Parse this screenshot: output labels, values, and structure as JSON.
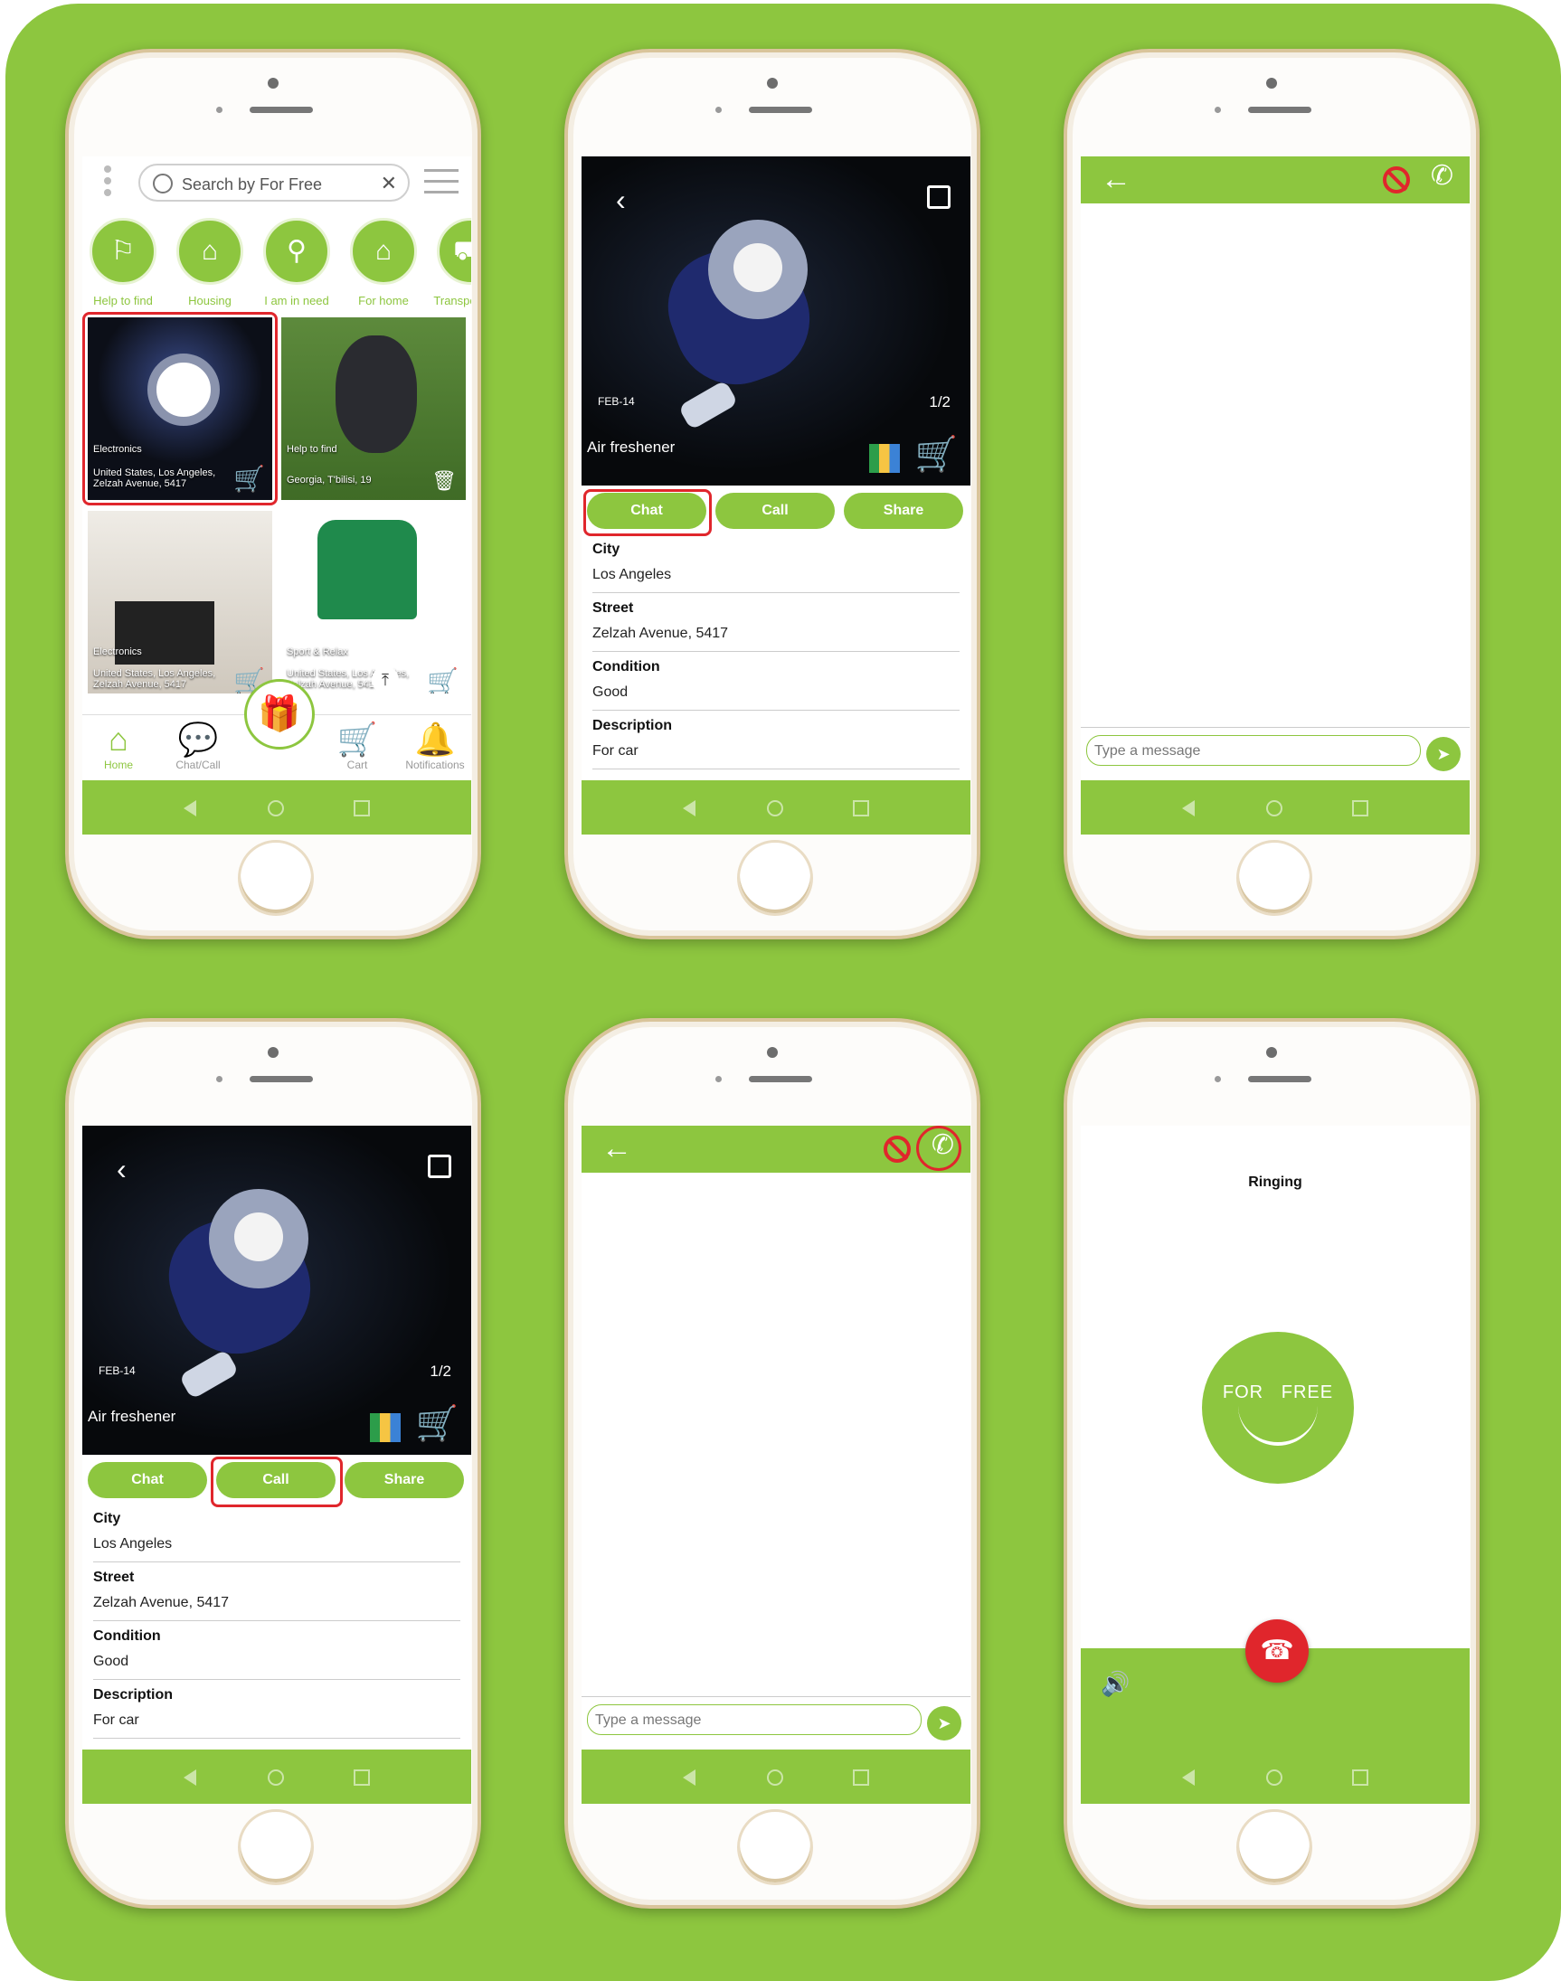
{
  "search": {
    "placeholder": "Search by For Free"
  },
  "categories": [
    "Help to find",
    "Housing",
    "I am in need",
    "For home",
    "Transpo & p..."
  ],
  "tiles": [
    {
      "category": "Electronics",
      "address": "United States, Los Angeles, Zelzah Avenue, 5417"
    },
    {
      "category": "Help to find",
      "address": "Georgia, T'bilisi, 19"
    },
    {
      "category": "Electronics",
      "address": "United States, Los Angeles, Zelzah Avenue, 5417"
    },
    {
      "category": "Sport & Relax",
      "address": "United States, Los Angeles, Zelzah Avenue, 5417"
    }
  ],
  "tabs": [
    "Home",
    "Chat/Call",
    "Cart",
    "Notifications"
  ],
  "item": {
    "date": "FEB-14",
    "counter": "1/2",
    "name": "Air freshener",
    "buttons": {
      "chat": "Chat",
      "call": "Call",
      "share": "Share"
    },
    "fields": [
      {
        "label": "City",
        "value": "Los Angeles"
      },
      {
        "label": "Street",
        "value": "Zelzah Avenue, 5417"
      },
      {
        "label": "Condition",
        "value": "Good"
      },
      {
        "label": "Description",
        "value": "For car"
      }
    ]
  },
  "chat": {
    "message_placeholder": "Type a message"
  },
  "call": {
    "status": "Ringing",
    "logo_word1": "FOR",
    "logo_word2": "FREE"
  },
  "colors": {
    "brand": "#8dc63f",
    "highlight": "#e0262c"
  }
}
